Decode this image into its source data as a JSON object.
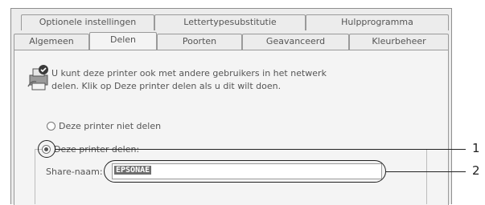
{
  "tabs_row1": [
    {
      "label": "Optionele instellingen"
    },
    {
      "label": "Lettertypesubstitutie"
    },
    {
      "label": "Hulpprogramma"
    }
  ],
  "tabs_row2": [
    {
      "label": "Algemeen"
    },
    {
      "label": "Delen",
      "active": true
    },
    {
      "label": "Poorten"
    },
    {
      "label": "Geavanceerd"
    },
    {
      "label": "Kleurbeheer"
    }
  ],
  "info": {
    "line1": "U kunt deze printer ook met andere gebruikers in het netwerk",
    "line2": "delen. Klik op Deze printer delen als u dit wilt doen.",
    "icon": "printer-share-icon"
  },
  "options": {
    "not_share_label": "Deze printer niet delen",
    "share_label": "Deze printer delen:",
    "selected": "share"
  },
  "share_name": {
    "label": "Share-naam:",
    "value": "EPSONAE"
  },
  "callouts": {
    "one": "1",
    "two": "2"
  }
}
